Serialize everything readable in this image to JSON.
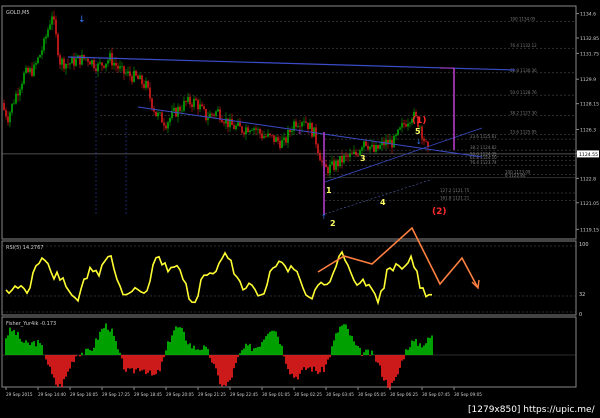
{
  "main_panel": {
    "symbol_label": "GOLD,M5",
    "price_ticks": [
      "1134.6",
      "1132.85",
      "1131.75",
      "1129.9",
      "1128.15",
      "1126.3",
      "1124.6",
      "1122.8",
      "1121.05",
      "1119.15"
    ],
    "current_price": "1124.55",
    "fib_levels": [
      {
        "text": "100 1134.05",
        "price": 1134.05
      },
      {
        "text": "76.4 1132.12",
        "price": 1132.12
      },
      {
        "text": "61.8 1130.36",
        "price": 1130.36
      },
      {
        "text": "50.0 1128.76",
        "price": 1128.76
      },
      {
        "text": "38.2 1127.30",
        "price": 1127.3
      },
      {
        "text": "23.6 1125.95",
        "price": 1125.95
      },
      {
        "text": "23.6 1125.61",
        "price": 1125.61
      },
      {
        "text": "38.2 1124.82",
        "price": 1124.82
      },
      {
        "text": "50.0 1124.35",
        "price": 1124.35
      },
      {
        "text": "61.8 1124.10",
        "price": 1124.1
      },
      {
        "text": "76.4 1123.74",
        "price": 1123.74
      },
      {
        "text": "100 1123.09",
        "price": 1123.09
      },
      {
        "text": "0 1122.84",
        "price": 1122.84
      },
      {
        "text": "127.2 1121.75",
        "price": 1121.75
      },
      {
        "text": "161.8 1121.21",
        "price": 1121.21
      }
    ],
    "wave_labels": [
      {
        "text": "1",
        "color": "#ffff66"
      },
      {
        "text": "2",
        "color": "#ffff66"
      },
      {
        "text": "3",
        "color": "#ffff66"
      },
      {
        "text": "4",
        "color": "#ffff66"
      },
      {
        "text": "5",
        "color": "#ffff66"
      },
      {
        "text": "(1)",
        "color": "#ff2a2a"
      },
      {
        "text": "(2)",
        "color": "#ff2a2a"
      }
    ]
  },
  "rsi_panel": {
    "label": "RSI(5) 14.2767",
    "ticks": [
      "100",
      "32",
      "0"
    ]
  },
  "fisher_panel": {
    "label": "Fisher_Yur4ik -0.173"
  },
  "time_axis": [
    "29 Sep 2015",
    "29 Sep 14:40",
    "29 Sep 16:05",
    "29 Sep 17:25",
    "29 Sep 18:45",
    "29 Sep 20:05",
    "29 Sep 21:25",
    "29 Sep 22:45",
    "30 Sep 01:05",
    "30 Sep 02:25",
    "30 Sep 03:45",
    "30 Sep 05:05",
    "30 Sep 06:25",
    "30 Sep 07:45",
    "30 Sep 09:05"
  ],
  "watermark": "[1279x850] https://upic.me/",
  "colors": {
    "bull": "#00c800",
    "bear": "#ff2020",
    "rsi": "#ffff33",
    "trend": "#3b4cc8",
    "fib": "#5a5a5a",
    "magenta": "#b43cc8",
    "orange": "#ff8040",
    "price_box": "#ffffff"
  }
}
